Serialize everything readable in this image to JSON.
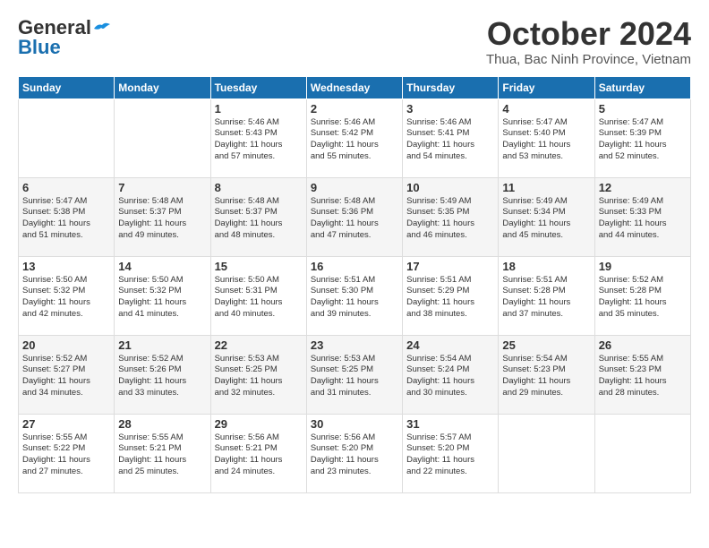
{
  "header": {
    "logo_general": "General",
    "logo_blue": "Blue",
    "month_title": "October 2024",
    "location": "Thua, Bac Ninh Province, Vietnam"
  },
  "days_of_week": [
    "Sunday",
    "Monday",
    "Tuesday",
    "Wednesday",
    "Thursday",
    "Friday",
    "Saturday"
  ],
  "weeks": [
    [
      {
        "day": "",
        "info": ""
      },
      {
        "day": "",
        "info": ""
      },
      {
        "day": "1",
        "info": "Sunrise: 5:46 AM\nSunset: 5:43 PM\nDaylight: 11 hours\nand 57 minutes."
      },
      {
        "day": "2",
        "info": "Sunrise: 5:46 AM\nSunset: 5:42 PM\nDaylight: 11 hours\nand 55 minutes."
      },
      {
        "day": "3",
        "info": "Sunrise: 5:46 AM\nSunset: 5:41 PM\nDaylight: 11 hours\nand 54 minutes."
      },
      {
        "day": "4",
        "info": "Sunrise: 5:47 AM\nSunset: 5:40 PM\nDaylight: 11 hours\nand 53 minutes."
      },
      {
        "day": "5",
        "info": "Sunrise: 5:47 AM\nSunset: 5:39 PM\nDaylight: 11 hours\nand 52 minutes."
      }
    ],
    [
      {
        "day": "6",
        "info": "Sunrise: 5:47 AM\nSunset: 5:38 PM\nDaylight: 11 hours\nand 51 minutes."
      },
      {
        "day": "7",
        "info": "Sunrise: 5:48 AM\nSunset: 5:37 PM\nDaylight: 11 hours\nand 49 minutes."
      },
      {
        "day": "8",
        "info": "Sunrise: 5:48 AM\nSunset: 5:37 PM\nDaylight: 11 hours\nand 48 minutes."
      },
      {
        "day": "9",
        "info": "Sunrise: 5:48 AM\nSunset: 5:36 PM\nDaylight: 11 hours\nand 47 minutes."
      },
      {
        "day": "10",
        "info": "Sunrise: 5:49 AM\nSunset: 5:35 PM\nDaylight: 11 hours\nand 46 minutes."
      },
      {
        "day": "11",
        "info": "Sunrise: 5:49 AM\nSunset: 5:34 PM\nDaylight: 11 hours\nand 45 minutes."
      },
      {
        "day": "12",
        "info": "Sunrise: 5:49 AM\nSunset: 5:33 PM\nDaylight: 11 hours\nand 44 minutes."
      }
    ],
    [
      {
        "day": "13",
        "info": "Sunrise: 5:50 AM\nSunset: 5:32 PM\nDaylight: 11 hours\nand 42 minutes."
      },
      {
        "day": "14",
        "info": "Sunrise: 5:50 AM\nSunset: 5:32 PM\nDaylight: 11 hours\nand 41 minutes."
      },
      {
        "day": "15",
        "info": "Sunrise: 5:50 AM\nSunset: 5:31 PM\nDaylight: 11 hours\nand 40 minutes."
      },
      {
        "day": "16",
        "info": "Sunrise: 5:51 AM\nSunset: 5:30 PM\nDaylight: 11 hours\nand 39 minutes."
      },
      {
        "day": "17",
        "info": "Sunrise: 5:51 AM\nSunset: 5:29 PM\nDaylight: 11 hours\nand 38 minutes."
      },
      {
        "day": "18",
        "info": "Sunrise: 5:51 AM\nSunset: 5:28 PM\nDaylight: 11 hours\nand 37 minutes."
      },
      {
        "day": "19",
        "info": "Sunrise: 5:52 AM\nSunset: 5:28 PM\nDaylight: 11 hours\nand 35 minutes."
      }
    ],
    [
      {
        "day": "20",
        "info": "Sunrise: 5:52 AM\nSunset: 5:27 PM\nDaylight: 11 hours\nand 34 minutes."
      },
      {
        "day": "21",
        "info": "Sunrise: 5:52 AM\nSunset: 5:26 PM\nDaylight: 11 hours\nand 33 minutes."
      },
      {
        "day": "22",
        "info": "Sunrise: 5:53 AM\nSunset: 5:25 PM\nDaylight: 11 hours\nand 32 minutes."
      },
      {
        "day": "23",
        "info": "Sunrise: 5:53 AM\nSunset: 5:25 PM\nDaylight: 11 hours\nand 31 minutes."
      },
      {
        "day": "24",
        "info": "Sunrise: 5:54 AM\nSunset: 5:24 PM\nDaylight: 11 hours\nand 30 minutes."
      },
      {
        "day": "25",
        "info": "Sunrise: 5:54 AM\nSunset: 5:23 PM\nDaylight: 11 hours\nand 29 minutes."
      },
      {
        "day": "26",
        "info": "Sunrise: 5:55 AM\nSunset: 5:23 PM\nDaylight: 11 hours\nand 28 minutes."
      }
    ],
    [
      {
        "day": "27",
        "info": "Sunrise: 5:55 AM\nSunset: 5:22 PM\nDaylight: 11 hours\nand 27 minutes."
      },
      {
        "day": "28",
        "info": "Sunrise: 5:55 AM\nSunset: 5:21 PM\nDaylight: 11 hours\nand 25 minutes."
      },
      {
        "day": "29",
        "info": "Sunrise: 5:56 AM\nSunset: 5:21 PM\nDaylight: 11 hours\nand 24 minutes."
      },
      {
        "day": "30",
        "info": "Sunrise: 5:56 AM\nSunset: 5:20 PM\nDaylight: 11 hours\nand 23 minutes."
      },
      {
        "day": "31",
        "info": "Sunrise: 5:57 AM\nSunset: 5:20 PM\nDaylight: 11 hours\nand 22 minutes."
      },
      {
        "day": "",
        "info": ""
      },
      {
        "day": "",
        "info": ""
      }
    ]
  ]
}
